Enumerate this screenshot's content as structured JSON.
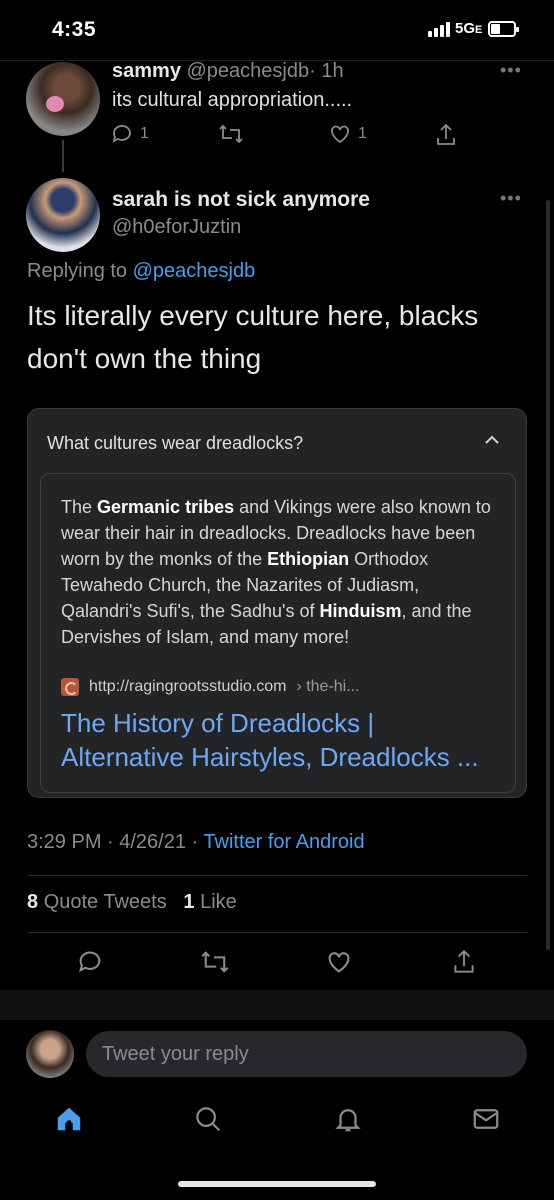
{
  "status_bar": {
    "time": "4:35",
    "network": "5G",
    "network_suffix": "E"
  },
  "tweet_parent": {
    "display_name": "sammy",
    "handle": "@peachesjdb",
    "age": "· 1h",
    "text": "its cultural appropriation.....",
    "reply_count": "1",
    "like_count": "1"
  },
  "tweet_main": {
    "display_name": "sarah is not sick anymore",
    "handle": "@h0eforJuztin",
    "replying_prefix": "Replying to",
    "replying_handle": "@peachesjdb",
    "text": "Its literally every culture here, blacks don't own the thing",
    "timestamp": "3:29 PM · 4/26/21 ·",
    "client": "Twitter for Android",
    "quote_count": "8",
    "quote_label": "Quote Tweets",
    "like_count": "1",
    "like_label": "Like"
  },
  "embedded_card": {
    "question": "What cultures wear dreadlocks?",
    "snippet": [
      {
        "t": "The ",
        "b": false
      },
      {
        "t": "Germanic tribes",
        "b": true
      },
      {
        "t": " and Vikings were also known to wear their hair in dreadlocks. Dreadlocks have been worn by the monks of the ",
        "b": false
      },
      {
        "t": "Ethiopian",
        "b": true
      },
      {
        "t": " Orthodox Tewahedo Church, the Nazarites of Judiasm, Qalandri's Sufi's, the Sadhu's of ",
        "b": false
      },
      {
        "t": "Hinduism",
        "b": true
      },
      {
        "t": ", and the Dervishes of Islam, and many more!",
        "b": false
      }
    ],
    "source_url": "http://ragingrootsstudio.com",
    "source_crumb": "› the-hi...",
    "source_title": "The History of Dreadlocks | Alternative Hairstyles, Dreadlocks ..."
  },
  "composer": {
    "placeholder": "Tweet your reply"
  },
  "colors": {
    "accent": "#4a9eeb",
    "link_title": "#6ea8f5",
    "background": "#000000",
    "card": "#232426"
  },
  "icons": [
    "reply-icon",
    "retweet-icon",
    "like-icon",
    "share-icon",
    "home-icon",
    "search-icon",
    "notifications-icon",
    "messages-icon",
    "chevron-up-icon",
    "more-icon"
  ]
}
